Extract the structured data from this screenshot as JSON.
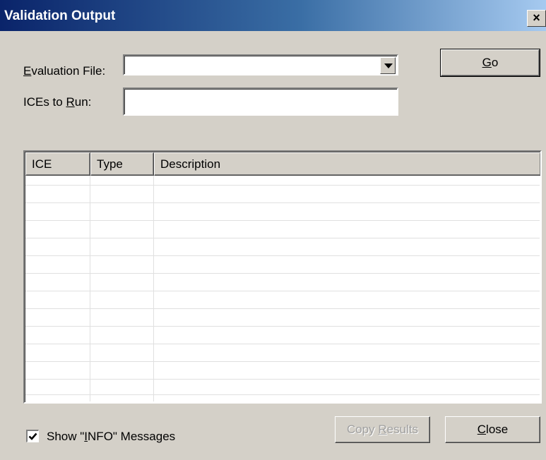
{
  "window": {
    "title": "Validation Output",
    "close_glyph": "×"
  },
  "form": {
    "evaluation_file": {
      "label_mnemonic": "E",
      "label_rest": "valuation File:",
      "value": ""
    },
    "ices_to_run": {
      "label_prefix": "ICEs to ",
      "label_mnemonic": "R",
      "label_rest": "un:",
      "value": ""
    }
  },
  "buttons": {
    "go": {
      "mnemonic": "G",
      "rest": "o"
    },
    "copy_results": {
      "prefix": "Copy ",
      "mnemonic": "R",
      "rest": "esults",
      "enabled": false
    },
    "close": {
      "mnemonic": "C",
      "rest": "lose"
    }
  },
  "results_table": {
    "columns": [
      "ICE",
      "Type",
      "Description"
    ],
    "rows": []
  },
  "show_info": {
    "checked": true,
    "label_prefix": "Show \"",
    "label_mnemonic": "I",
    "label_rest": "NFO\" Messages"
  },
  "icons": {
    "combo_arrow": "chevron-down-icon",
    "checkmark": "checkmark-icon"
  }
}
